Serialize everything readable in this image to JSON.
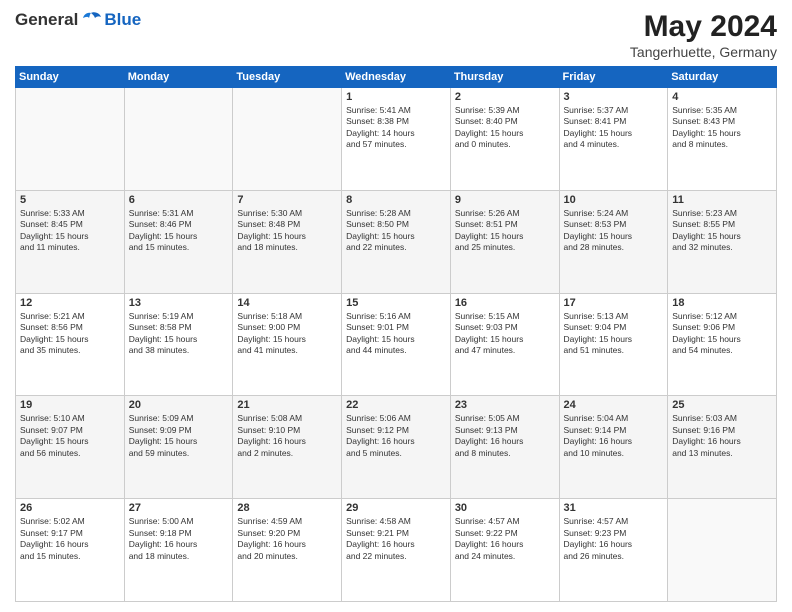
{
  "header": {
    "logo_general": "General",
    "logo_blue": "Blue",
    "month_year": "May 2024",
    "location": "Tangerhuette, Germany"
  },
  "days_of_week": [
    "Sunday",
    "Monday",
    "Tuesday",
    "Wednesday",
    "Thursday",
    "Friday",
    "Saturday"
  ],
  "weeks": [
    [
      {
        "day": "",
        "info": ""
      },
      {
        "day": "",
        "info": ""
      },
      {
        "day": "",
        "info": ""
      },
      {
        "day": "1",
        "info": "Sunrise: 5:41 AM\nSunset: 8:38 PM\nDaylight: 14 hours\nand 57 minutes."
      },
      {
        "day": "2",
        "info": "Sunrise: 5:39 AM\nSunset: 8:40 PM\nDaylight: 15 hours\nand 0 minutes."
      },
      {
        "day": "3",
        "info": "Sunrise: 5:37 AM\nSunset: 8:41 PM\nDaylight: 15 hours\nand 4 minutes."
      },
      {
        "day": "4",
        "info": "Sunrise: 5:35 AM\nSunset: 8:43 PM\nDaylight: 15 hours\nand 8 minutes."
      }
    ],
    [
      {
        "day": "5",
        "info": "Sunrise: 5:33 AM\nSunset: 8:45 PM\nDaylight: 15 hours\nand 11 minutes."
      },
      {
        "day": "6",
        "info": "Sunrise: 5:31 AM\nSunset: 8:46 PM\nDaylight: 15 hours\nand 15 minutes."
      },
      {
        "day": "7",
        "info": "Sunrise: 5:30 AM\nSunset: 8:48 PM\nDaylight: 15 hours\nand 18 minutes."
      },
      {
        "day": "8",
        "info": "Sunrise: 5:28 AM\nSunset: 8:50 PM\nDaylight: 15 hours\nand 22 minutes."
      },
      {
        "day": "9",
        "info": "Sunrise: 5:26 AM\nSunset: 8:51 PM\nDaylight: 15 hours\nand 25 minutes."
      },
      {
        "day": "10",
        "info": "Sunrise: 5:24 AM\nSunset: 8:53 PM\nDaylight: 15 hours\nand 28 minutes."
      },
      {
        "day": "11",
        "info": "Sunrise: 5:23 AM\nSunset: 8:55 PM\nDaylight: 15 hours\nand 32 minutes."
      }
    ],
    [
      {
        "day": "12",
        "info": "Sunrise: 5:21 AM\nSunset: 8:56 PM\nDaylight: 15 hours\nand 35 minutes."
      },
      {
        "day": "13",
        "info": "Sunrise: 5:19 AM\nSunset: 8:58 PM\nDaylight: 15 hours\nand 38 minutes."
      },
      {
        "day": "14",
        "info": "Sunrise: 5:18 AM\nSunset: 9:00 PM\nDaylight: 15 hours\nand 41 minutes."
      },
      {
        "day": "15",
        "info": "Sunrise: 5:16 AM\nSunset: 9:01 PM\nDaylight: 15 hours\nand 44 minutes."
      },
      {
        "day": "16",
        "info": "Sunrise: 5:15 AM\nSunset: 9:03 PM\nDaylight: 15 hours\nand 47 minutes."
      },
      {
        "day": "17",
        "info": "Sunrise: 5:13 AM\nSunset: 9:04 PM\nDaylight: 15 hours\nand 51 minutes."
      },
      {
        "day": "18",
        "info": "Sunrise: 5:12 AM\nSunset: 9:06 PM\nDaylight: 15 hours\nand 54 minutes."
      }
    ],
    [
      {
        "day": "19",
        "info": "Sunrise: 5:10 AM\nSunset: 9:07 PM\nDaylight: 15 hours\nand 56 minutes."
      },
      {
        "day": "20",
        "info": "Sunrise: 5:09 AM\nSunset: 9:09 PM\nDaylight: 15 hours\nand 59 minutes."
      },
      {
        "day": "21",
        "info": "Sunrise: 5:08 AM\nSunset: 9:10 PM\nDaylight: 16 hours\nand 2 minutes."
      },
      {
        "day": "22",
        "info": "Sunrise: 5:06 AM\nSunset: 9:12 PM\nDaylight: 16 hours\nand 5 minutes."
      },
      {
        "day": "23",
        "info": "Sunrise: 5:05 AM\nSunset: 9:13 PM\nDaylight: 16 hours\nand 8 minutes."
      },
      {
        "day": "24",
        "info": "Sunrise: 5:04 AM\nSunset: 9:14 PM\nDaylight: 16 hours\nand 10 minutes."
      },
      {
        "day": "25",
        "info": "Sunrise: 5:03 AM\nSunset: 9:16 PM\nDaylight: 16 hours\nand 13 minutes."
      }
    ],
    [
      {
        "day": "26",
        "info": "Sunrise: 5:02 AM\nSunset: 9:17 PM\nDaylight: 16 hours\nand 15 minutes."
      },
      {
        "day": "27",
        "info": "Sunrise: 5:00 AM\nSunset: 9:18 PM\nDaylight: 16 hours\nand 18 minutes."
      },
      {
        "day": "28",
        "info": "Sunrise: 4:59 AM\nSunset: 9:20 PM\nDaylight: 16 hours\nand 20 minutes."
      },
      {
        "day": "29",
        "info": "Sunrise: 4:58 AM\nSunset: 9:21 PM\nDaylight: 16 hours\nand 22 minutes."
      },
      {
        "day": "30",
        "info": "Sunrise: 4:57 AM\nSunset: 9:22 PM\nDaylight: 16 hours\nand 24 minutes."
      },
      {
        "day": "31",
        "info": "Sunrise: 4:57 AM\nSunset: 9:23 PM\nDaylight: 16 hours\nand 26 minutes."
      },
      {
        "day": "",
        "info": ""
      }
    ]
  ]
}
